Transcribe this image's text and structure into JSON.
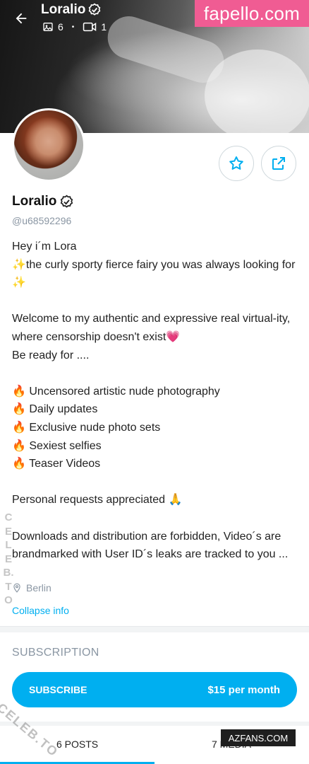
{
  "header": {
    "title": "Loralio",
    "photo_count": "6",
    "separator": "•",
    "video_count": "1"
  },
  "watermark": {
    "top_right": "fapello.com",
    "bottom_right": "AZFANS.COM",
    "side_vertical": "CELEB.TO",
    "side_diagonal": "CELEB.TO"
  },
  "profile": {
    "name": "Loralio",
    "handle": "@u68592296",
    "bio_lines": [
      "Hey i´m Lora",
      "✨the curly sporty fierce fairy you was always looking for ✨",
      "",
      "Welcome to my authentic and expressive real virtual-ity, where censorship doesn't exist💗",
      "Be ready for ....",
      "",
      "🔥 Uncensored artistic nude photography",
      "🔥 Daily updates",
      "🔥 Exclusive nude photo sets",
      "🔥 Sexiest selfies",
      "🔥 Teaser Videos",
      "",
      "Personal requests appreciated 🙏",
      "",
      "Downloads and distribution are forbidden, Video´s are brandmarked with User ID´s leaks are tracked to you ..."
    ],
    "location": "Berlin",
    "collapse_label": "Collapse info"
  },
  "subscription": {
    "section_title": "SUBSCRIPTION",
    "button_label": "SUBSCRIBE",
    "price": "$15 per month"
  },
  "tabs": [
    {
      "label": "6 POSTS",
      "active": true
    },
    {
      "label": "7 MEDIA",
      "active": false
    }
  ],
  "colors": {
    "accent": "#00aff0",
    "muted": "#8a96a3",
    "fapello_pink": "#f05c93"
  }
}
